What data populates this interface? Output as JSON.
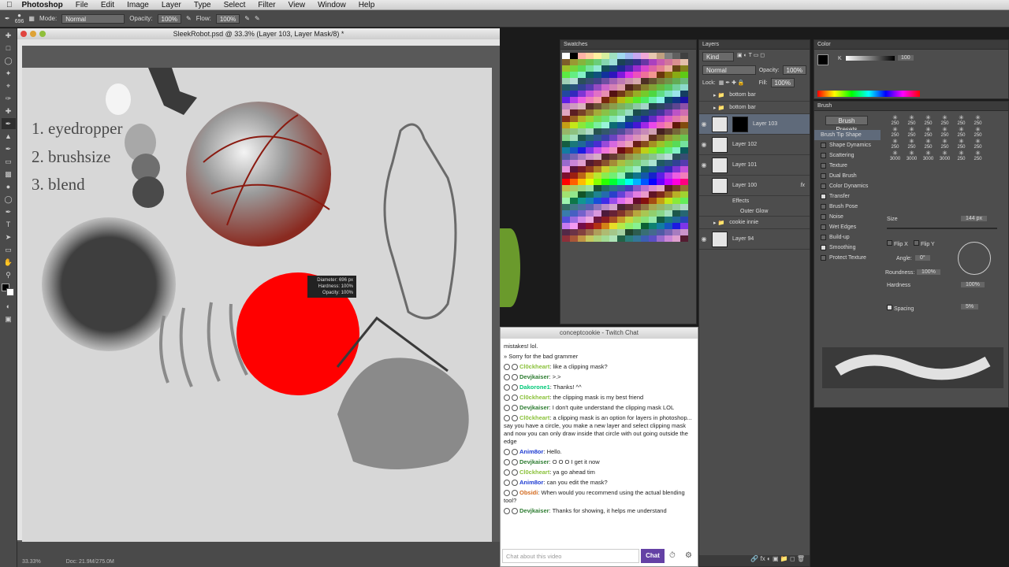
{
  "menubar": {
    "app": "Photoshop",
    "items": [
      "File",
      "Edit",
      "Image",
      "Layer",
      "Type",
      "Select",
      "Filter",
      "View",
      "Window",
      "Help"
    ]
  },
  "options": {
    "brush_size": "696",
    "mode_label": "Mode:",
    "mode_value": "Normal",
    "opacity_label": "Opacity:",
    "opacity_value": "100%",
    "flow_label": "Flow:",
    "flow_value": "100%"
  },
  "document": {
    "title": "SleekRobot.psd @ 33.3% (Layer 103, Layer Mask/8) *",
    "zoom": "33.33%",
    "doc_size": "Doc: 21.9M/275.0M"
  },
  "canvas": {
    "notes": [
      "1. eyedropper",
      "2. brushsize",
      "3. blend"
    ],
    "tooltip": {
      "diameter": "Diameter: 696 px",
      "hardness": "Hardness: 100%",
      "opacity": "Opacity: 100%"
    }
  },
  "swatches": {
    "title": "Swatches"
  },
  "layers": {
    "title": "Layers",
    "kind": "Kind",
    "blend": "Normal",
    "opacity_label": "Opacity:",
    "opacity_value": "100%",
    "lock_label": "Lock:",
    "fill_label": "Fill:",
    "fill_value": "100%",
    "rows": [
      {
        "name": "bottom bar"
      },
      {
        "name": "bottom bar"
      },
      {
        "name": "Layer 103"
      },
      {
        "name": "Layer 102"
      },
      {
        "name": "Layer 101"
      },
      {
        "name": "Layer 100"
      },
      {
        "name": "Effects"
      },
      {
        "name": "Outer Glow"
      },
      {
        "name": "cookie innie"
      },
      {
        "name": "Layer 94"
      }
    ]
  },
  "color": {
    "title": "Color",
    "k_label": "K",
    "k_value": "100"
  },
  "brush": {
    "title": "Brush",
    "presets_button": "Brush Presets",
    "options": [
      "Brush Tip Shape",
      "Shape Dynamics",
      "Scattering",
      "Texture",
      "Dual Brush",
      "Color Dynamics",
      "Transfer",
      "Brush Pose",
      "Noise",
      "Wet Edges",
      "Build-up",
      "Smoothing",
      "Protect Texture"
    ],
    "checked": [
      false,
      false,
      false,
      false,
      false,
      false,
      true,
      false,
      false,
      false,
      false,
      true,
      false
    ],
    "grid": [
      "250",
      "250",
      "250",
      "250",
      "250",
      "250",
      "250",
      "250",
      "250",
      "250",
      "250",
      "250",
      "250",
      "250",
      "250",
      "250",
      "250",
      "250",
      "3000",
      "3000",
      "3000",
      "3000",
      "250",
      "250"
    ],
    "size_label": "Size",
    "size_value": "144 px",
    "flipx": "Flip X",
    "flipy": "Flip Y",
    "angle_label": "Angle:",
    "angle_value": "0°",
    "roundness_label": "Roundness:",
    "roundness_value": "100%",
    "hardness_label": "Hardness",
    "hardness_value": "100%",
    "spacing_label": "Spacing",
    "spacing_value": "5%"
  },
  "chat": {
    "title": "conceptcookie - Twitch Chat",
    "input_placeholder": "Chat about this video",
    "chat_button": "Chat",
    "messages": [
      {
        "user": "",
        "text": "mistakes! lol.",
        "color": "#222"
      },
      {
        "user": "",
        "text": "» Sorry for the bad grammer",
        "color": "#222"
      },
      {
        "user": "Cl0ckheart",
        "text": ": like a clipping mask?",
        "color": "#8ac13a"
      },
      {
        "user": "Devjkaiser",
        "text": ": >.>",
        "color": "#2e7d32"
      },
      {
        "user": "Dakorone1",
        "text": ": Thanks! ^^",
        "color": "#00c878"
      },
      {
        "user": "Cl0ckheart",
        "text": ": the clipping mask is my best friend",
        "color": "#8ac13a"
      },
      {
        "user": "Devjkaiser",
        "text": ": I don't quite understand the clipping mask LOL",
        "color": "#2e7d32"
      },
      {
        "user": "Cl0ckheart",
        "text": ": a clipping mask is an option for layers in photoshop... say you have a circle, you make a new layer and select clipping mask and now you can only draw inside that circle with out going outside the edge",
        "color": "#8ac13a"
      },
      {
        "user": "Anim8or",
        "text": ": Hello.",
        "color": "#1e3cd2"
      },
      {
        "user": "Devjkaiser",
        "text": ": O O O I get it now",
        "color": "#2e7d32"
      },
      {
        "user": "Cl0ckheart",
        "text": ": ya go ahead tim",
        "color": "#8ac13a"
      },
      {
        "user": "Anim8or",
        "text": ": can you edit the mask?",
        "color": "#1e3cd2"
      },
      {
        "user": "Obsidi",
        "text": ": When would you recommend using the actual blending tool?",
        "color": "#d2691e"
      },
      {
        "user": "Devjkaiser",
        "text": ": Thanks for showing, it helps me understand",
        "color": "#2e7d32"
      }
    ]
  }
}
